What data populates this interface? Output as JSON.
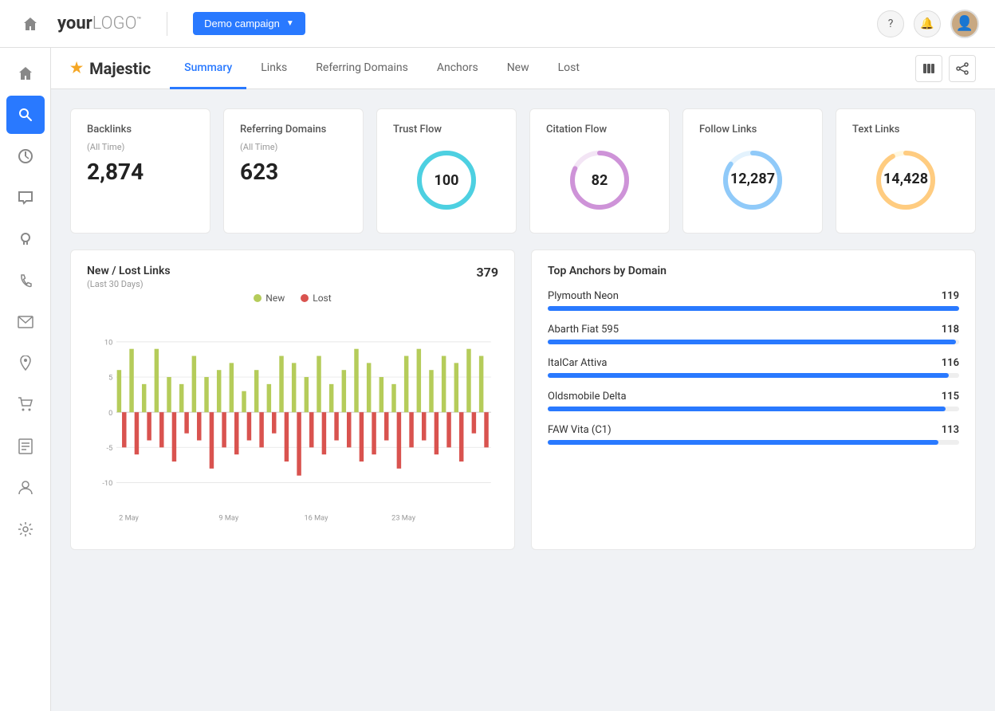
{
  "header": {
    "logo": "yourLOGO",
    "campaign_label": "Demo campaign",
    "help_label": "?",
    "notification_icon": "🔔"
  },
  "sidebar": {
    "items": [
      {
        "id": "home",
        "icon": "⊞",
        "label": "Home"
      },
      {
        "id": "search",
        "icon": "🔍",
        "label": "Search",
        "active": true
      },
      {
        "id": "analytics",
        "icon": "◷",
        "label": "Analytics"
      },
      {
        "id": "chat",
        "icon": "💬",
        "label": "Chat"
      },
      {
        "id": "lightbulb",
        "icon": "💡",
        "label": "Insights"
      },
      {
        "id": "phone",
        "icon": "📞",
        "label": "Phone"
      },
      {
        "id": "email",
        "icon": "✉",
        "label": "Email"
      },
      {
        "id": "location",
        "icon": "📍",
        "label": "Location"
      },
      {
        "id": "cart",
        "icon": "🛒",
        "label": "Commerce"
      },
      {
        "id": "reports",
        "icon": "📋",
        "label": "Reports"
      },
      {
        "id": "user",
        "icon": "👤",
        "label": "Users"
      },
      {
        "id": "settings",
        "icon": "⚙",
        "label": "Settings"
      }
    ]
  },
  "subnav": {
    "brand": "Majestic",
    "tabs": [
      {
        "id": "summary",
        "label": "Summary",
        "active": true
      },
      {
        "id": "links",
        "label": "Links"
      },
      {
        "id": "referring-domains",
        "label": "Referring Domains"
      },
      {
        "id": "anchors",
        "label": "Anchors"
      },
      {
        "id": "new",
        "label": "New"
      },
      {
        "id": "lost",
        "label": "Lost"
      }
    ]
  },
  "metrics": [
    {
      "id": "backlinks",
      "title": "Backlinks",
      "subtitle": "(All Time)",
      "value": "2,874",
      "type": "number"
    },
    {
      "id": "referring-domains",
      "title": "Referring Domains",
      "subtitle": "(All Time)",
      "value": "623",
      "type": "number"
    },
    {
      "id": "trust-flow",
      "title": "Trust Flow",
      "subtitle": "",
      "value": "100",
      "type": "gauge",
      "gauge_color": "#4dd0e1",
      "gauge_bg": "#e0f7fa",
      "percent": 100
    },
    {
      "id": "citation-flow",
      "title": "Citation Flow",
      "subtitle": "",
      "value": "82",
      "type": "gauge",
      "gauge_color": "#ce93d8",
      "gauge_bg": "#f3e5f5",
      "percent": 82
    },
    {
      "id": "follow-links",
      "title": "Follow Links",
      "subtitle": "",
      "value": "12,287",
      "type": "gauge",
      "gauge_color": "#90caf9",
      "gauge_bg": "#e3f2fd",
      "percent": 85
    },
    {
      "id": "text-links",
      "title": "Text Links",
      "subtitle": "",
      "value": "14,428",
      "type": "gauge",
      "gauge_color": "#ffcc80",
      "gauge_bg": "#fff8e1",
      "percent": 92
    }
  ],
  "chart": {
    "title": "New / Lost Links",
    "subtitle": "(Last 30 Days)",
    "total": "379",
    "legend": [
      {
        "label": "New",
        "color": "#b5cc5a"
      },
      {
        "label": "Lost",
        "color": "#d9534f"
      }
    ],
    "x_labels": [
      "2 May",
      "9 May",
      "16 May",
      "23 May"
    ],
    "y_labels": [
      "10",
      "5",
      "0",
      "-5",
      "-10"
    ],
    "bars": [
      {
        "new": 6,
        "lost": -5
      },
      {
        "new": 9,
        "lost": -6
      },
      {
        "new": 4,
        "lost": -4
      },
      {
        "new": 9,
        "lost": -5
      },
      {
        "new": 5,
        "lost": -7
      },
      {
        "new": 4,
        "lost": -3
      },
      {
        "new": 8,
        "lost": -4
      },
      {
        "new": 5,
        "lost": -8
      },
      {
        "new": 6,
        "lost": -5
      },
      {
        "new": 7,
        "lost": -6
      },
      {
        "new": 3,
        "lost": -4
      },
      {
        "new": 6,
        "lost": -5
      },
      {
        "new": 4,
        "lost": -3
      },
      {
        "new": 8,
        "lost": -7
      },
      {
        "new": 7,
        "lost": -9
      },
      {
        "new": 5,
        "lost": -5
      },
      {
        "new": 8,
        "lost": -6
      },
      {
        "new": 4,
        "lost": -4
      },
      {
        "new": 6,
        "lost": -5
      },
      {
        "new": 9,
        "lost": -7
      },
      {
        "new": 7,
        "lost": -6
      },
      {
        "new": 5,
        "lost": -4
      },
      {
        "new": 4,
        "lost": -8
      },
      {
        "new": 8,
        "lost": -5
      },
      {
        "new": 9,
        "lost": -4
      },
      {
        "new": 6,
        "lost": -6
      },
      {
        "new": 8,
        "lost": -5
      },
      {
        "new": 7,
        "lost": -7
      },
      {
        "new": 9,
        "lost": -3
      },
      {
        "new": 8,
        "lost": -5
      }
    ]
  },
  "anchors": {
    "title": "Top Anchors by Domain",
    "items": [
      {
        "name": "Plymouth Neon",
        "count": 119,
        "max": 119
      },
      {
        "name": "Abarth Fiat 595",
        "count": 118,
        "max": 119
      },
      {
        "name": "ItalCar Attiva",
        "count": 116,
        "max": 119
      },
      {
        "name": "Oldsmobile Delta",
        "count": 115,
        "max": 119
      },
      {
        "name": "FAW Vita (C1)",
        "count": 113,
        "max": 119
      }
    ]
  }
}
